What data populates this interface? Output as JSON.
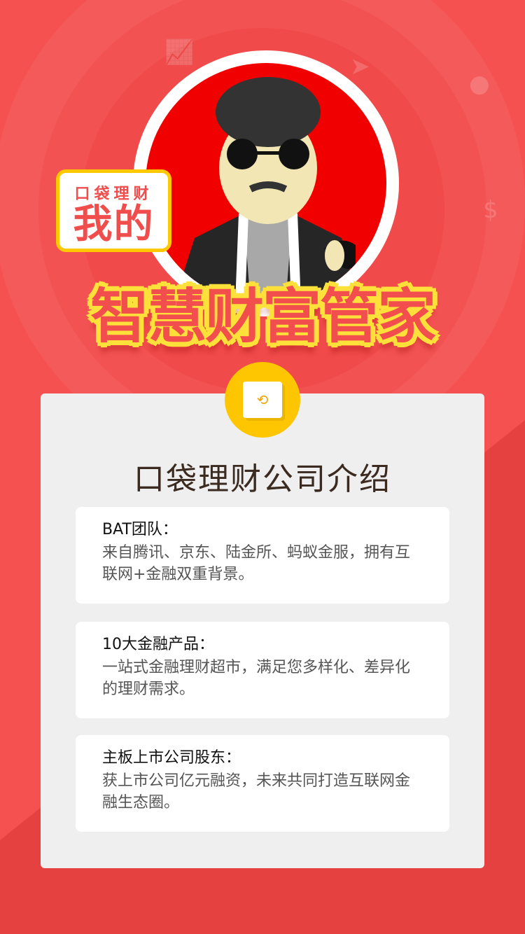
{
  "bubble": {
    "small": "口袋理财",
    "big": "我的"
  },
  "headline": "智慧财富管家",
  "card": {
    "title": "口袋理财公司介绍",
    "badge_icon": "wallet-icon",
    "items": [
      {
        "heading": "BAT团队：",
        "body": "来自腾讯、京东、陆金所、蚂蚁金服，拥有互联网+金融双重背景。"
      },
      {
        "heading": "10大金融产品：",
        "body": "一站式金融理财超市，满足您多样化、差异化的理财需求。"
      },
      {
        "heading": "主板上市公司股东：",
        "body": "获上市公司亿元融资，未来共同打造互联网金融生态圈。"
      }
    ]
  },
  "colors": {
    "background": "#f55151",
    "accent": "#fec600",
    "headline": "#f24e4e"
  }
}
